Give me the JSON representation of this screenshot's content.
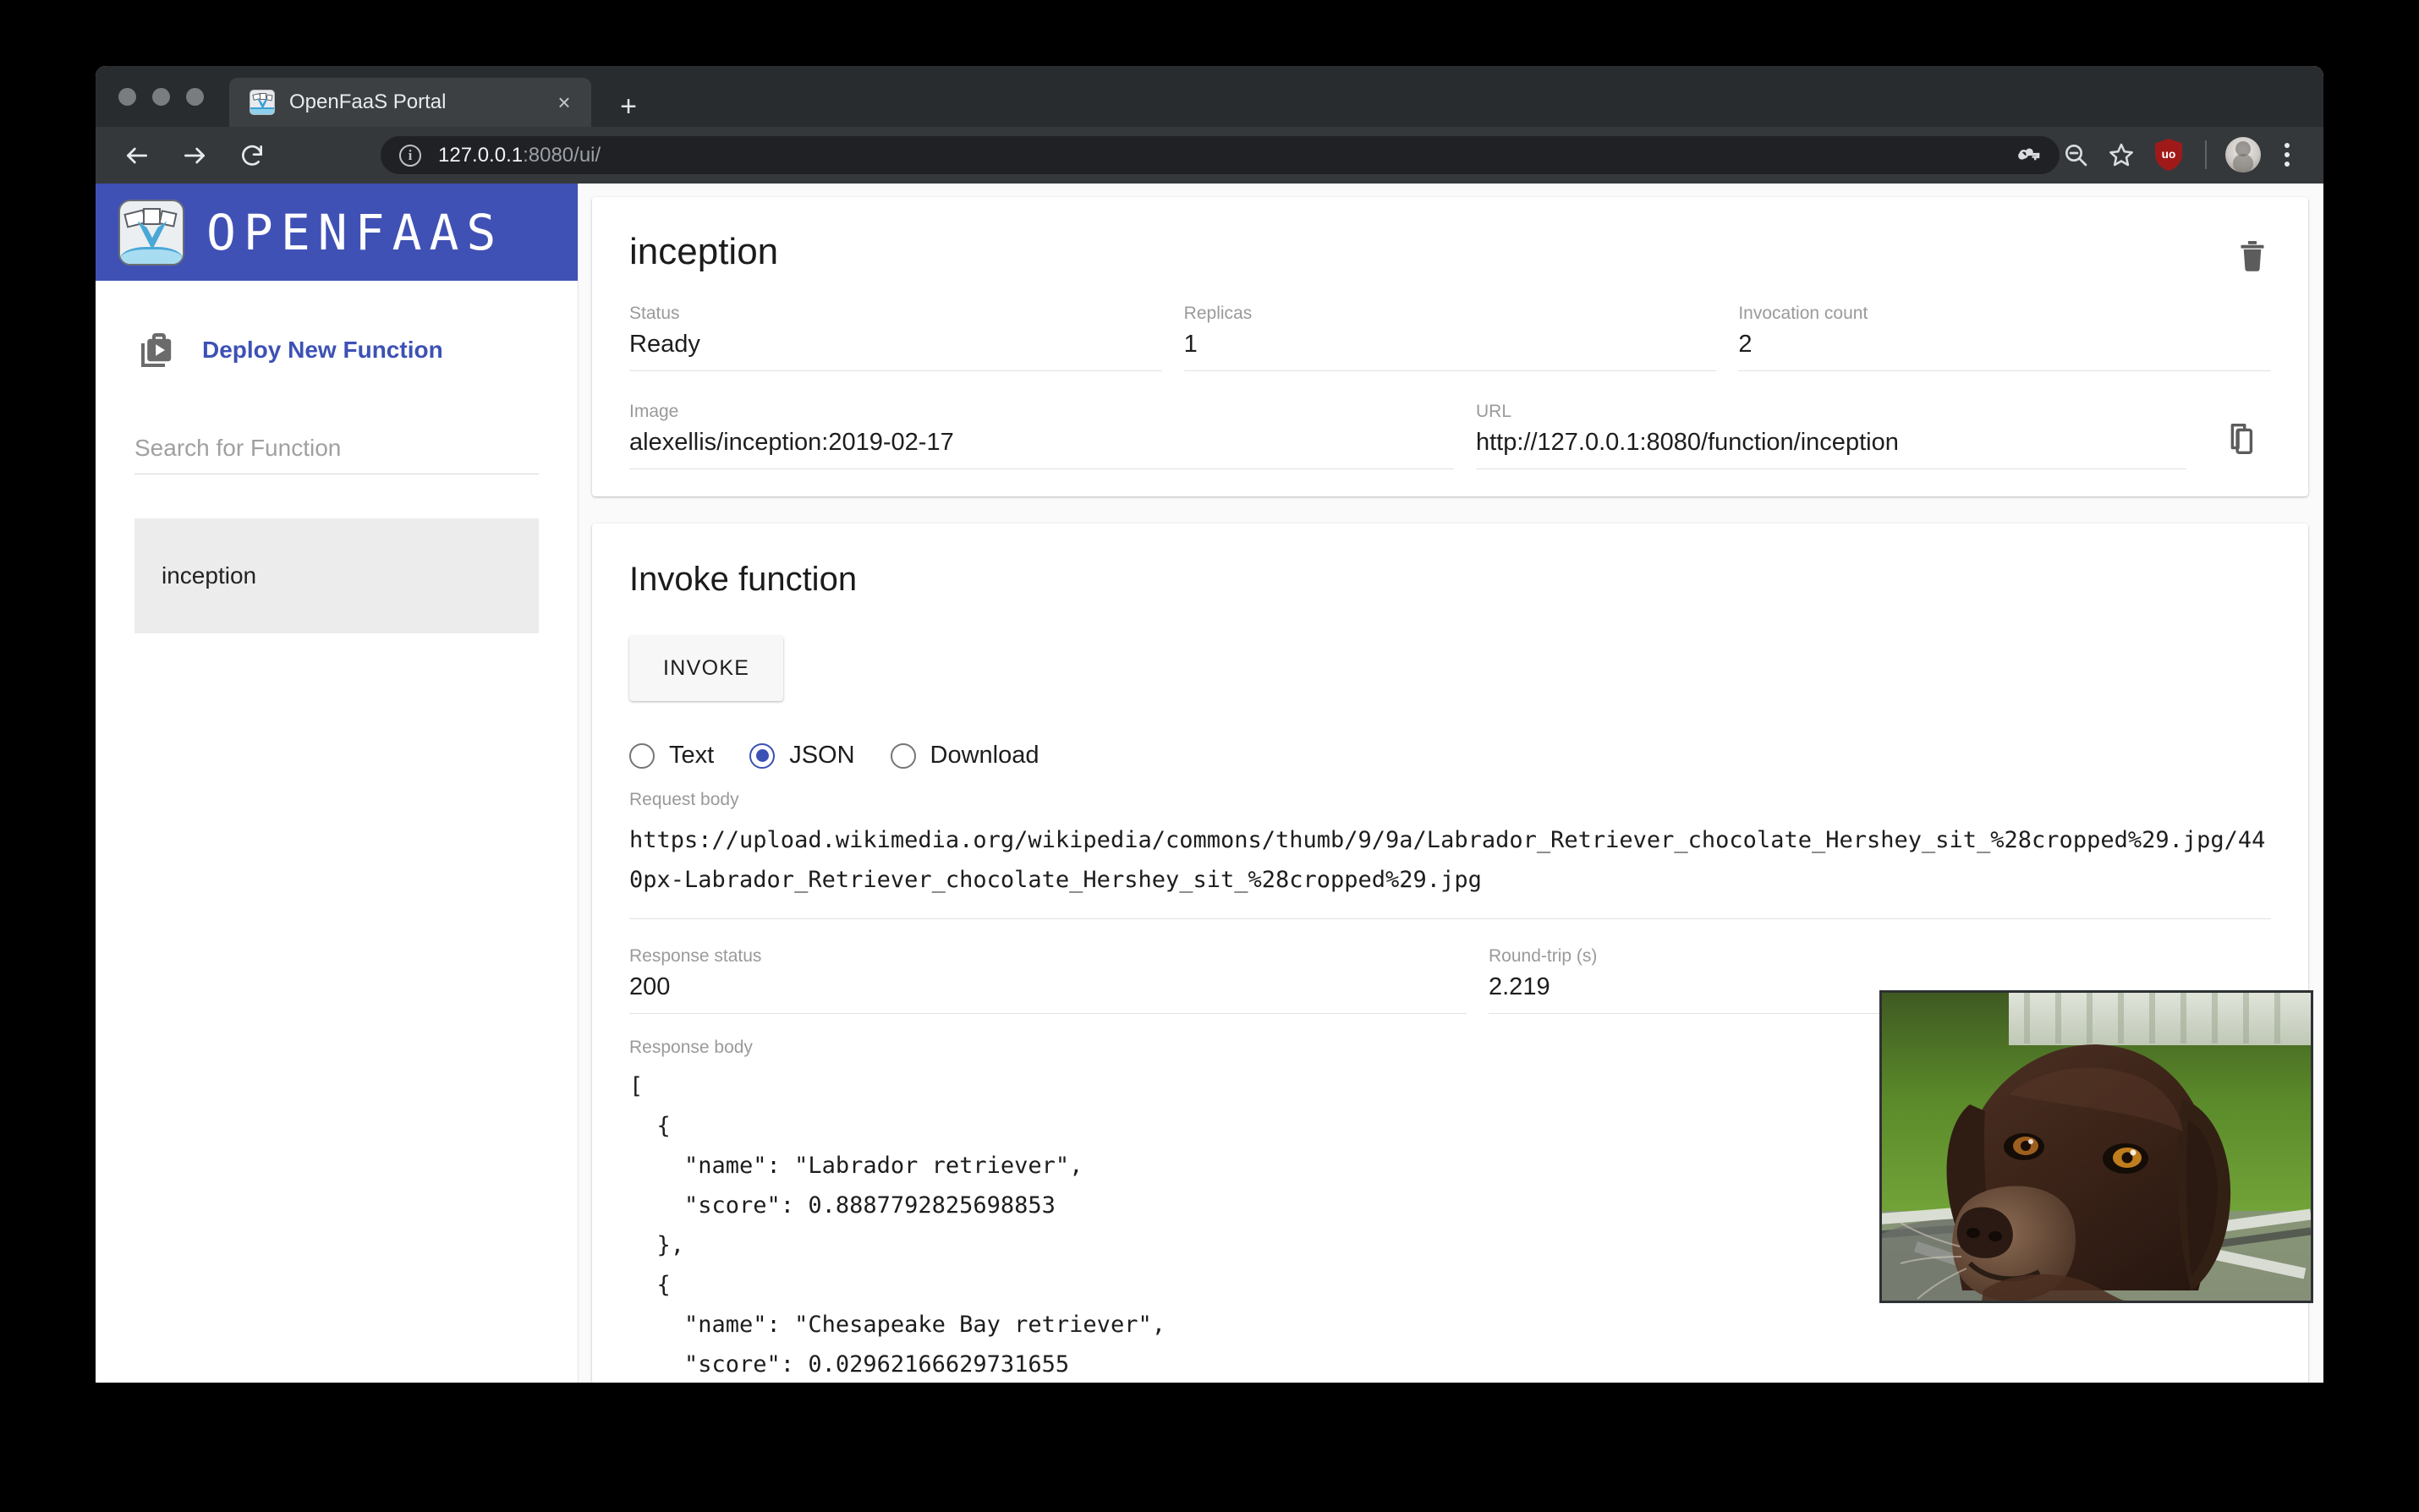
{
  "browser": {
    "tab_title": "OpenFaaS Portal",
    "tab_favicon_icon": "openfaas-whale-icon",
    "close_tab_label": "×",
    "new_tab_label": "+",
    "back_icon": "arrow-left-icon",
    "forward_icon": "arrow-right-icon",
    "reload_icon": "reload-icon",
    "site_info_icon": "info-circle-icon",
    "url_host": "127.0.0.1",
    "url_path": ":8080/ui/",
    "toolbar_icons": [
      "key-icon",
      "zoom-out-icon",
      "star-icon",
      "ublock-origin-icon",
      "avatar",
      "menu-dots-icon"
    ],
    "ublock_label": "uo"
  },
  "sidebar": {
    "brand_text": "OPENFAAS",
    "brand_logo_icon": "openfaas-whale-logo",
    "brand_color": "#4051b5",
    "deploy_label": "Deploy New Function",
    "deploy_icon": "deploy-bag-play-icon",
    "deploy_link_color": "#3d51b5",
    "search_placeholder": "Search for Function",
    "search_value": "",
    "functions": [
      {
        "name": "inception",
        "selected": true
      }
    ]
  },
  "details": {
    "title": "inception",
    "delete_icon": "trash-icon",
    "copy_icon": "copy-icon",
    "fields": [
      {
        "label": "Status",
        "value": "Ready"
      },
      {
        "label": "Replicas",
        "value": "1"
      },
      {
        "label": "Invocation count",
        "value": "2"
      }
    ],
    "image_label": "Image",
    "image_value": "alexellis/inception:2019-02-17",
    "url_label": "URL",
    "url_value": "http://127.0.0.1:8080/function/inception"
  },
  "invoke": {
    "title": "Invoke function",
    "button_label": "INVOKE",
    "response_type_options": [
      {
        "label": "Text",
        "checked": false
      },
      {
        "label": "JSON",
        "checked": true
      },
      {
        "label": "Download",
        "checked": false
      }
    ],
    "selected_response_type": "JSON",
    "request_body_label": "Request body",
    "request_body_value": "https://upload.wikimedia.org/wikipedia/commons/thumb/9/9a/Labrador_Retriever_chocolate_Hershey_sit_%28cropped%29.jpg/440px-Labrador_Retriever_chocolate_Hershey_sit_%28cropped%29.jpg",
    "response_status_label": "Response status",
    "response_status_value": "200",
    "roundtrip_label": "Round-trip (s)",
    "roundtrip_value": "2.219",
    "response_body_label": "Response body",
    "response_body_value": "[\n  {\n    \"name\": \"Labrador retriever\",\n    \"score\": 0.8887792825698853\n  },\n  {\n    \"name\": \"Chesapeake Bay retriever\",\n    \"score\": 0.02962166629731655",
    "result_image_alt": "chocolate Labrador retriever sitting on grass"
  },
  "colors": {
    "brand": "#4051b5",
    "accent": "#3d51b5",
    "selected_item_bg": "#ececec",
    "label_gray": "#9a9a9a"
  }
}
